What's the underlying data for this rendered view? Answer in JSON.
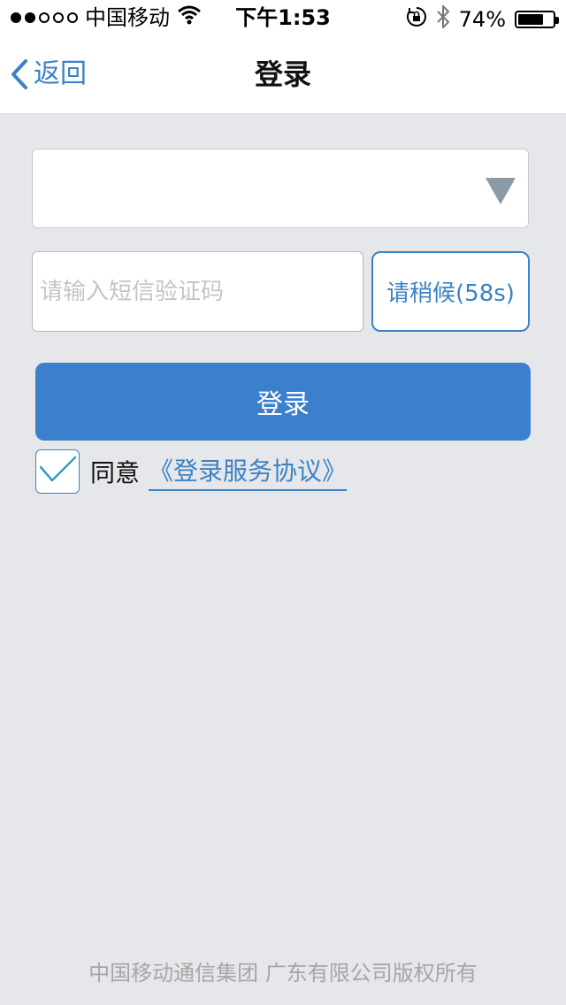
{
  "status_bar": {
    "carrier": "中国移动",
    "time": "下午1:53",
    "battery_text": "74%",
    "battery_level": 0.74,
    "signal_filled": 2,
    "signal_total": 5
  },
  "nav": {
    "back_label": "返回",
    "title": "登录"
  },
  "form": {
    "phone_value": "",
    "code_placeholder": "请输入短信验证码",
    "code_value": "",
    "countdown_label": "请稍候(58s)",
    "login_label": "登录",
    "agree_checked": true,
    "agree_label": "同意",
    "agreement_link": "《登录服务协议》"
  },
  "footer": {
    "copyright": "中国移动通信集团 广东有限公司版权所有"
  },
  "colors": {
    "accent": "#3b82c4",
    "login_button": "#3a80cc",
    "background": "#e6e7eb"
  }
}
